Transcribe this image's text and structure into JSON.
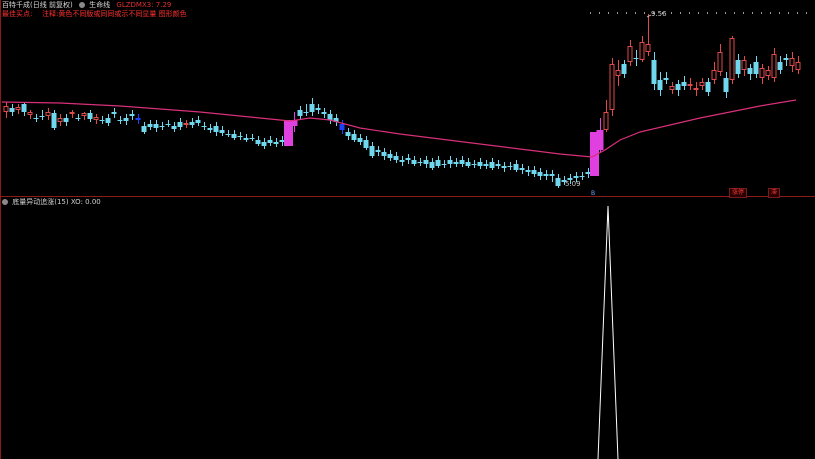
{
  "header": {
    "title": "百特千成(日线 前复权)",
    "indicator_name": "生命线",
    "indicator_value_label": "GLZDMX3: 7.29",
    "buy_label": "最佳买点:",
    "notice": "注释:黄色不同版或同同或示不同显量 图形颜色"
  },
  "main_chart": {
    "high_label": "9.56",
    "low_label": "5.09",
    "buy_tag": "B",
    "badges": [
      "涨停",
      "滞"
    ]
  },
  "sub_panel": {
    "title": "底量异动追涨(15) XO: 0.00"
  },
  "colors": {
    "up": "#e04a4a",
    "down": "#6fd8ee",
    "ma": "#d8307a",
    "signal": "#e040e0",
    "blue_marker": "#2040ff",
    "spike": "#ffffff",
    "divider": "#8b1a1a"
  },
  "icons": [
    "circle-icon"
  ]
}
